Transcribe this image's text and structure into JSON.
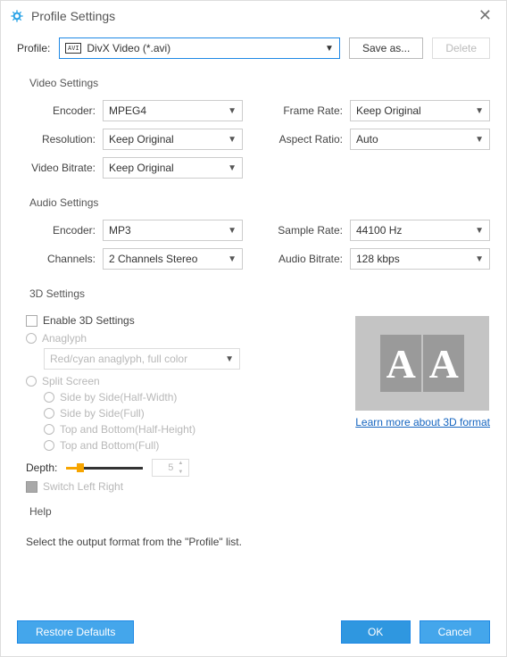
{
  "title": "Profile Settings",
  "profile": {
    "label": "Profile:",
    "value": "DivX Video (*.avi)",
    "icon_text": "AVI",
    "save_as": "Save as...",
    "delete": "Delete"
  },
  "video": {
    "title": "Video Settings",
    "encoder_label": "Encoder:",
    "encoder": "MPEG4",
    "resolution_label": "Resolution:",
    "resolution": "Keep Original",
    "bitrate_label": "Video Bitrate:",
    "bitrate": "Keep Original",
    "framerate_label": "Frame Rate:",
    "framerate": "Keep Original",
    "aspect_label": "Aspect Ratio:",
    "aspect": "Auto"
  },
  "audio": {
    "title": "Audio Settings",
    "encoder_label": "Encoder:",
    "encoder": "MP3",
    "channels_label": "Channels:",
    "channels": "2 Channels Stereo",
    "samplerate_label": "Sample Rate:",
    "samplerate": "44100 Hz",
    "bitrate_label": "Audio Bitrate:",
    "bitrate": "128 kbps"
  },
  "threeD": {
    "title": "3D Settings",
    "enable_label": "Enable 3D Settings",
    "anaglyph_label": "Anaglyph",
    "anaglyph_value": "Red/cyan anaglyph, full color",
    "split_label": "Split Screen",
    "opt_sbs_half": "Side by Side(Half-Width)",
    "opt_sbs_full": "Side by Side(Full)",
    "opt_tb_half": "Top and Bottom(Half-Height)",
    "opt_tb_full": "Top and Bottom(Full)",
    "depth_label": "Depth:",
    "depth_value": "5",
    "switch_label": "Switch Left Right",
    "link": "Learn more about 3D format"
  },
  "help": {
    "title": "Help",
    "text": "Select the output format from the \"Profile\" list."
  },
  "footer": {
    "restore": "Restore Defaults",
    "ok": "OK",
    "cancel": "Cancel"
  }
}
